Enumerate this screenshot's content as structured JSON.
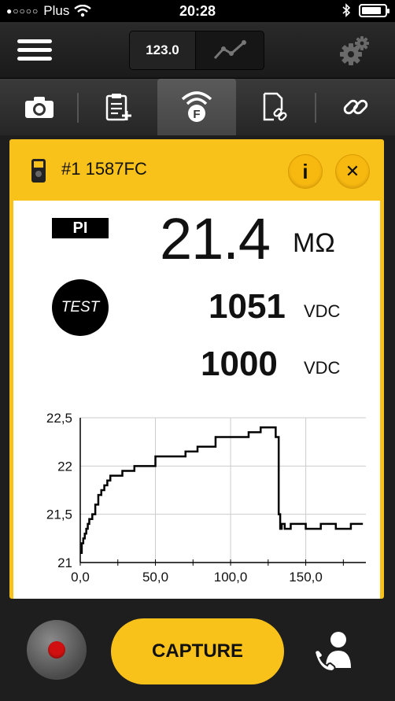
{
  "status_bar": {
    "carrier": "Plus",
    "time": "20:28",
    "battery_level": 0.85
  },
  "toolbar": {
    "numeric_view_label": "123.0",
    "icons": [
      "menu-icon",
      "trend-graph-icon",
      "gear-icon"
    ]
  },
  "tabs": [
    {
      "icon": "camera-icon",
      "active": false
    },
    {
      "icon": "clipboard-add-icon",
      "active": false
    },
    {
      "icon": "fluke-connect-wireless-icon",
      "active": true
    },
    {
      "icon": "document-link-icon",
      "active": false
    },
    {
      "icon": "link-icon",
      "active": false
    }
  ],
  "card": {
    "device_title": "#1 1587FC",
    "info_label": "i",
    "close_label": "✕",
    "mode_badge": "PI",
    "main_value": "21.4",
    "main_unit": "MΩ",
    "test_label": "TEST",
    "reading1_value": "1051",
    "reading1_unit": "VDC",
    "reading2_value": "1000",
    "reading2_unit": "VDC"
  },
  "chart_data": {
    "type": "line",
    "title": "",
    "xlabel": "",
    "ylabel": "",
    "xlim": [
      0,
      190
    ],
    "ylim": [
      21,
      22.5
    ],
    "x_ticks": [
      "0,0",
      "50,0",
      "100,0",
      "150,0"
    ],
    "x_tick_values": [
      0,
      50,
      100,
      150
    ],
    "y_ticks": [
      "21",
      "21,5",
      "22",
      "22,5"
    ],
    "y_tick_values": [
      21,
      21.5,
      22,
      22.5
    ],
    "grid": true,
    "series": [
      {
        "x": [
          0,
          1,
          2,
          3,
          4,
          5,
          6,
          8,
          10,
          12,
          14,
          16,
          18,
          20,
          24,
          28,
          32,
          36,
          40,
          44,
          50,
          60,
          70,
          74,
          78,
          84,
          90,
          96,
          104,
          112,
          120,
          126,
          130,
          132,
          133,
          134,
          136,
          140,
          150,
          160,
          170,
          180,
          188
        ],
        "y": [
          21.1,
          21.2,
          21.25,
          21.3,
          21.35,
          21.4,
          21.45,
          21.5,
          21.6,
          21.7,
          21.75,
          21.8,
          21.85,
          21.9,
          21.9,
          21.95,
          21.95,
          22.0,
          22.0,
          22.0,
          22.1,
          22.1,
          22.15,
          22.15,
          22.2,
          22.2,
          22.3,
          22.3,
          22.3,
          22.35,
          22.4,
          22.4,
          22.3,
          21.5,
          21.35,
          21.4,
          21.35,
          21.4,
          21.35,
          21.4,
          21.35,
          21.4,
          21.4
        ]
      }
    ]
  },
  "bottom": {
    "capture_label": "CAPTURE",
    "icons": [
      "record-icon",
      "contact-call-icon"
    ]
  }
}
